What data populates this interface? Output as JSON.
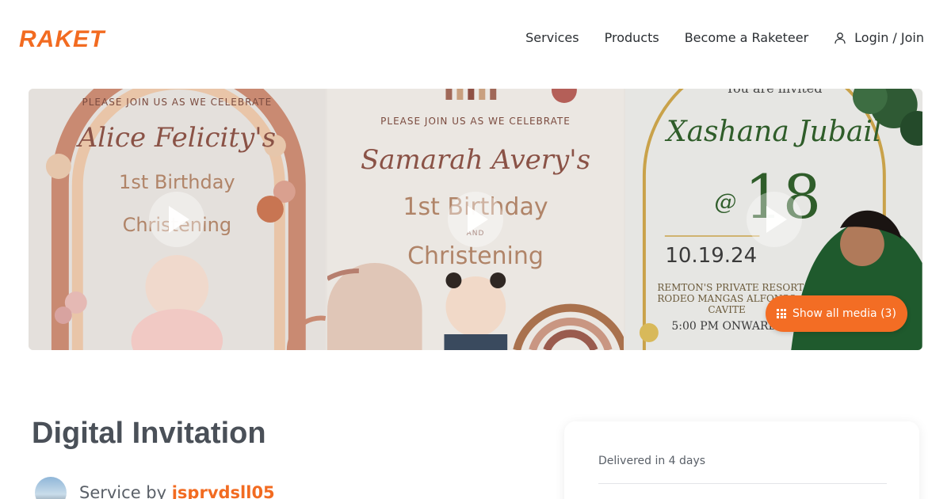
{
  "brand": {
    "logo_text": "RAKET",
    "accent": "#f26b21"
  },
  "nav": {
    "items": [
      "Services",
      "Products",
      "Become a Raketeer"
    ],
    "login_label": "Login / Join"
  },
  "gallery": {
    "panels": [
      {
        "small": "PLEASE JOIN US AS WE CELEBRATE",
        "name": "Alice Felicity's",
        "line1": "1st Birthday",
        "line2": "Christening"
      },
      {
        "small": "PLEASE JOIN US AS WE CELEBRATE",
        "name": "Samarah Avery's",
        "line1": "1st Birthday",
        "and": "AND",
        "line2": "Christening"
      },
      {
        "small": "You are invited",
        "name": "Xashana Jubail",
        "at": "@",
        "age": "18",
        "date": "10.19.24",
        "venue1": "REMTON'S PRIVATE RESORT",
        "venue2": "RODEO MANGAS ALFONSO",
        "venue3": "CAVITE",
        "time": "5:00 PM ONWARDS"
      }
    ],
    "show_all_label": "Show all media (3)"
  },
  "service": {
    "title": "Digital Invitation",
    "provider_prefix": "Service by",
    "provider_name": "jsprvdsll05"
  },
  "order_card": {
    "delivered": "Delivered in 4 days"
  }
}
